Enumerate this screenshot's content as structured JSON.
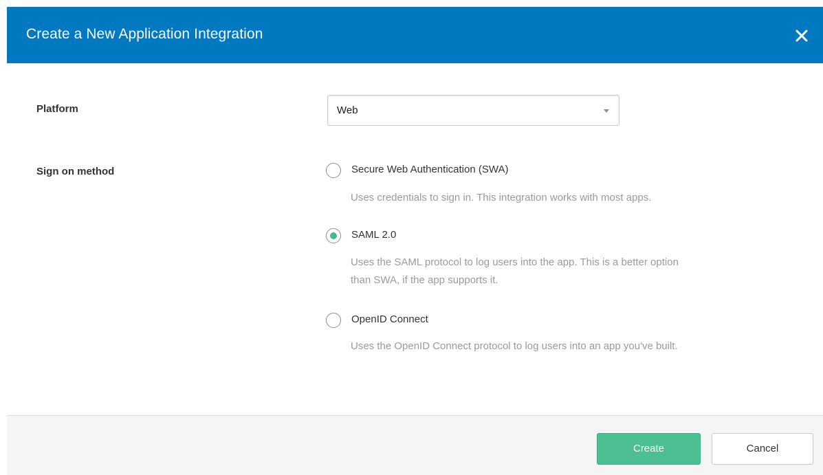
{
  "dialog": {
    "title": "Create a New Application Integration",
    "close_icon": "close-icon"
  },
  "form": {
    "platform": {
      "label": "Platform",
      "selected": "Web",
      "caret_icon": "caret-down-icon"
    },
    "sign_on": {
      "label": "Sign on method",
      "options": [
        {
          "label": "Secure Web Authentication (SWA)",
          "description": "Uses credentials to sign in. This integration works with most apps.",
          "selected": false
        },
        {
          "label": "SAML 2.0",
          "description_line1": "Uses the SAML protocol to log users into the app. This is a better option",
          "description_line2": "than SWA, if the app supports it.",
          "selected": true
        },
        {
          "label": "OpenID Connect",
          "description": "Uses the OpenID Connect protocol to log users into an app you've built.",
          "selected": false
        }
      ]
    }
  },
  "footer": {
    "create_label": "Create",
    "cancel_label": "Cancel"
  },
  "colors": {
    "header": "#0079c1",
    "accent": "#46b98d",
    "create_button": "#4cbf95"
  }
}
